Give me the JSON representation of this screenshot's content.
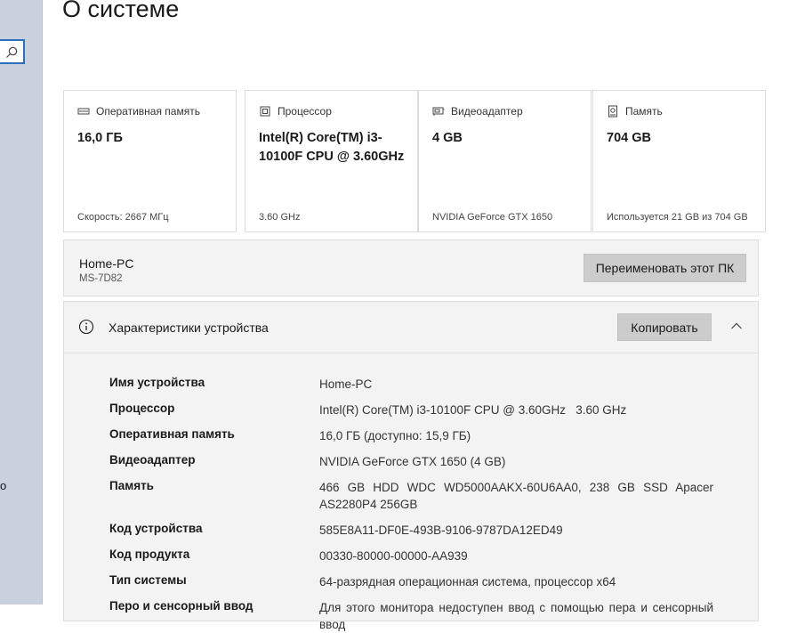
{
  "page": {
    "title": "О системе"
  },
  "sidebar": {
    "fragment_text": "о"
  },
  "cards": [
    {
      "label": "Оперативная память",
      "value": "16,0 ГБ",
      "sub": "Скорость: 2667 МГц",
      "icon": "ram-icon"
    },
    {
      "label": "Процессор",
      "value": "Intel(R) Core(TM) i3-10100F CPU @ 3.60GHz",
      "sub": "3.60 GHz",
      "icon": "cpu-icon"
    },
    {
      "label": "Видеоадаптер",
      "value": "4 GB",
      "sub": "NVIDIA GeForce GTX 1650",
      "icon": "gpu-icon"
    },
    {
      "label": "Память",
      "value": "704 GB",
      "sub": "Используется 21 GB из 704 GB",
      "icon": "storage-icon"
    }
  ],
  "pc": {
    "name": "Home-PC",
    "model": "MS-7D82",
    "rename_label": "Переименовать этот ПК"
  },
  "specs": {
    "title": "Характеристики устройства",
    "copy_label": "Копировать",
    "rows": [
      {
        "key": "Имя устройства",
        "value": "Home-PC"
      },
      {
        "key": "Процессор",
        "value": "Intel(R) Core(TM) i3-10100F CPU @ 3.60GHz   3.60 GHz"
      },
      {
        "key": "Оперативная память",
        "value": "16,0 ГБ (доступно: 15,9 ГБ)"
      },
      {
        "key": "Видеоадаптер",
        "value": "NVIDIA GeForce GTX 1650 (4 GB)"
      },
      {
        "key": "Память",
        "value": "466 GB HDD WDC WD5000AAKX-60U6AA0, 238 GB SSD Apacer AS2280P4 256GB"
      },
      {
        "key": "Код устройства",
        "value": "585E8A11-DF0E-493B-9106-9787DA12ED49"
      },
      {
        "key": "Код продукта",
        "value": "00330-80000-00000-AA939"
      },
      {
        "key": "Тип системы",
        "value": "64-разрядная операционная система, процессор x64"
      },
      {
        "key": "Перо и сенсорный ввод",
        "value": "Для этого монитора недоступен ввод с помощью пера и сенсорный ввод"
      }
    ]
  },
  "colors": {
    "accent": "#2b6fbf",
    "panel_bg": "#f3f3f3",
    "button_bg": "#cccccc"
  }
}
